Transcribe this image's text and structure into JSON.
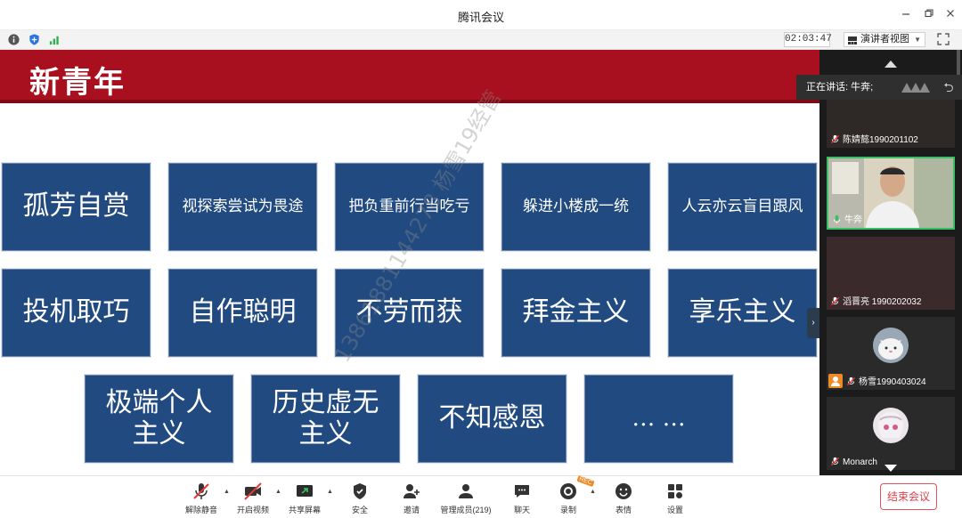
{
  "window": {
    "title": "腾讯会议",
    "buttons": [
      "minimize",
      "restore",
      "close"
    ]
  },
  "infobar": {
    "icons": [
      "info-icon",
      "shield-icon",
      "signal-icon"
    ],
    "elapsed": "02:03:47",
    "view_mode": "演讲者视图",
    "fullscreen": "fullscreen-icon"
  },
  "slide": {
    "header": "新青年",
    "watermark": "13861881144278 杨雪19经管",
    "cards_row1": [
      "孤芳自赏",
      "视探索尝试为畏途",
      "把负重前行当吃亏",
      "躲进小楼成一统",
      "人云亦云盲目跟风"
    ],
    "cards_row2": [
      "投机取巧",
      "自作聪明",
      "不劳而获",
      "拜金主义",
      "享乐主义"
    ],
    "cards_row3": [
      "极端个人主义",
      "历史虚无主义",
      "不知感恩",
      "… …"
    ]
  },
  "panel": {
    "speaking_label": "正在讲话: 牛奔;",
    "participants": [
      {
        "name": "陈婧懿1990201102",
        "muted": true
      },
      {
        "name": "牛奔",
        "muted": false,
        "speaking": true
      },
      {
        "name": "滔晋亮 1990202032",
        "muted": true
      },
      {
        "name": "杨雪1990403024",
        "muted": true
      },
      {
        "name": "Monarch",
        "muted": true
      }
    ]
  },
  "toolbar": {
    "unmute": "解除静音",
    "start_video": "开启视频",
    "share_screen": "共享屏幕",
    "security": "安全",
    "invite": "邀请",
    "manage_members": "管理成员(219)",
    "chat": "聊天",
    "record": "录制",
    "record_badge": "REC",
    "reactions": "表情",
    "settings": "设置",
    "end_meeting": "结束会议"
  },
  "colors": {
    "header_red": "#a8101f",
    "card_blue": "#204a80",
    "accent_green": "#3bbf63",
    "end_red": "#e03e49"
  }
}
